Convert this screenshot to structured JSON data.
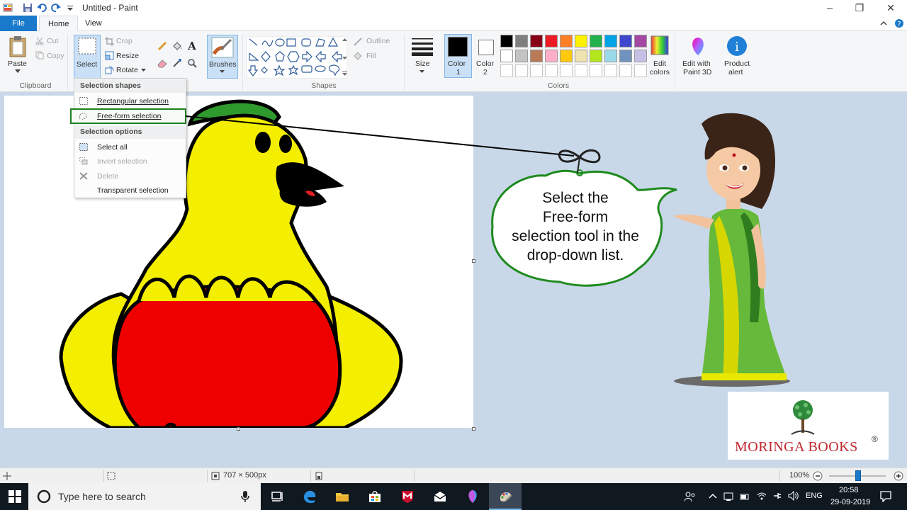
{
  "window": {
    "title": "Untitled - Paint",
    "controls": {
      "minimize": "–",
      "restore": "❐",
      "close": "✕"
    }
  },
  "tabs": {
    "file": "File",
    "home": "Home",
    "view": "View"
  },
  "ribbon": {
    "clipboard": {
      "paste": "Paste",
      "cut": "Cut",
      "copy": "Copy",
      "label": "Clipboard"
    },
    "image": {
      "select": "Select",
      "crop": "Crop",
      "resize": "Resize",
      "rotate": "Rotate"
    },
    "tools": {
      "brushes": "Brushes"
    },
    "shapes": {
      "outline": "Outline",
      "fill": "Fill",
      "label": "Shapes"
    },
    "size": "Size",
    "color1": {
      "line1": "Color",
      "line2": "1"
    },
    "color2": {
      "line1": "Color",
      "line2": "2"
    },
    "colors_label": "Colors",
    "edit_colors": {
      "line1": "Edit",
      "line2": "colors"
    },
    "paint3d": {
      "line1": "Edit with",
      "line2": "Paint 3D"
    },
    "product_alert": {
      "line1": "Product",
      "line2": "alert"
    },
    "palette": [
      "#000000",
      "#7f7f7f",
      "#880015",
      "#ed1c24",
      "#ff7f27",
      "#fff200",
      "#22b14c",
      "#00a2e8",
      "#3f48cc",
      "#a349a4",
      "#ffffff",
      "#c3c3c3",
      "#b97a57",
      "#ffaec9",
      "#ffc90e",
      "#efe4b0",
      "#b5e61d",
      "#99d9ea",
      "#7092be",
      "#c8bfe7"
    ]
  },
  "select_menu": {
    "shapes_header": "Selection shapes",
    "rectangular": "Rectangular selection",
    "freeform": "Free-form selection",
    "options_header": "Selection options",
    "select_all": "Select all",
    "invert": "Invert selection",
    "delete": "Delete",
    "transparent": "Transparent selection"
  },
  "callout": {
    "line1": "Select the",
    "line2": "Free-form",
    "line3": "selection tool in the",
    "line4": "drop-down list."
  },
  "logo": {
    "text": "MORINGA BOOKS",
    "reg": "®"
  },
  "status": {
    "dimensions": "707 × 500px",
    "zoom": "100%"
  },
  "taskbar": {
    "search_placeholder": "Type here to search",
    "lang": "ENG",
    "time": "20:58",
    "date": "29-09-2019"
  }
}
